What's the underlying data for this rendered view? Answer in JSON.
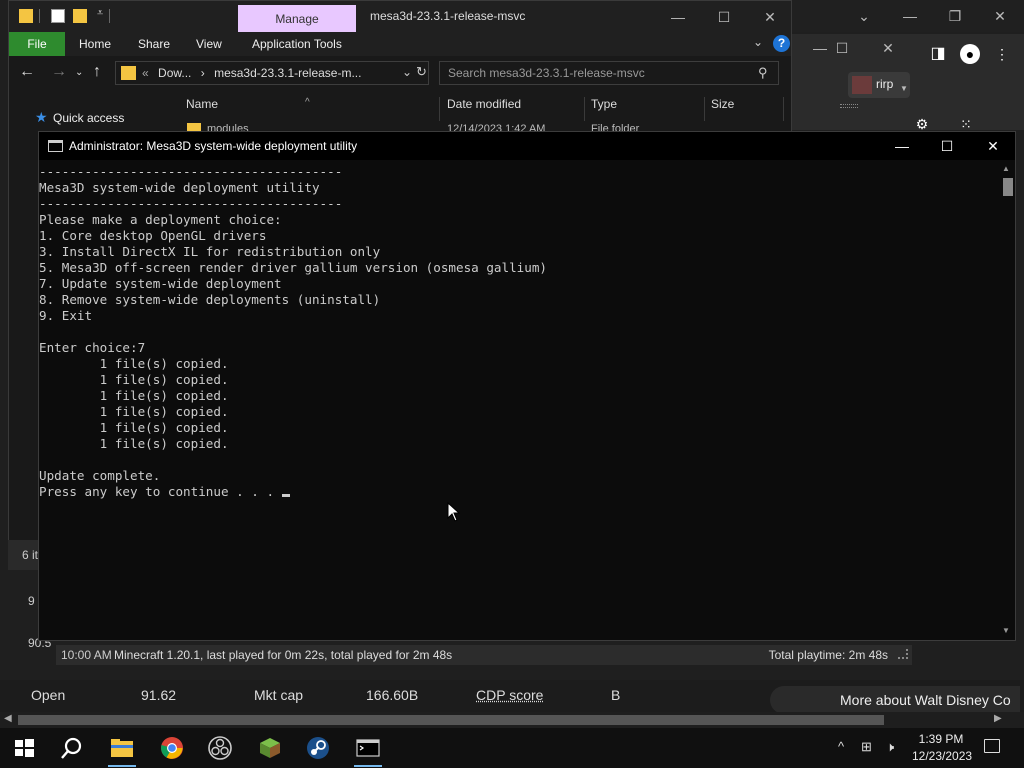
{
  "explorer": {
    "manage_tab": "Manage",
    "title": "mesa3d-23.3.1-release-msvc",
    "ribbon": {
      "file": "File",
      "tabs": [
        "Home",
        "Share",
        "View",
        "Application Tools"
      ]
    },
    "address_segments": [
      "«",
      "Dow...",
      "›",
      "mesa3d-23.3.1-release-m..."
    ],
    "search_placeholder": "Search mesa3d-23.3.1-release-msvc",
    "nav": {
      "quick_access": "Quick access"
    },
    "columns": [
      "Name",
      "Date modified",
      "Type",
      "Size"
    ],
    "first_row": {
      "name": "modules",
      "date": "12/14/2023 1:42 AM",
      "type": "File folder"
    },
    "status_items": "6 it"
  },
  "browser": {
    "profile_name": "rirp"
  },
  "console": {
    "title": "Administrator:  Mesa3D system-wide deployment utility",
    "lines": [
      "----------------------------------------",
      "Mesa3D system-wide deployment utility",
      "----------------------------------------",
      "Please make a deployment choice:",
      "1. Core desktop OpenGL drivers",
      "3. Install DirectX IL for redistribution only",
      "5. Mesa3D off-screen render driver gallium version (osmesa gallium)",
      "7. Update system-wide deployment",
      "8. Remove system-wide deployments (uninstall)",
      "9. Exit",
      "",
      "Enter choice:7",
      "        1 file(s) copied.",
      "        1 file(s) copied.",
      "        1 file(s) copied.",
      "        1 file(s) copied.",
      "        1 file(s) copied.",
      "        1 file(s) copied.",
      "",
      "Update complete.",
      "Press any key to continue . . . "
    ]
  },
  "minecraft_status": {
    "time": "10:00 AM",
    "text": "Minecraft 1.20.1, last played for 0m 22s, total played for 2m 48s",
    "total": "Total playtime: 2m 48s"
  },
  "stocks": {
    "open_label": "Open",
    "open_value": "91.62",
    "mktcap_label": "Mkt cap",
    "mktcap_value": "166.60B",
    "cdp_label": "CDP score",
    "cdp_value": "B",
    "more_about": "More about Walt Disney Co",
    "left_num1": "9",
    "left_num2": "90.5"
  },
  "taskbar": {
    "time": "1:39 PM",
    "date": "12/23/2023",
    "accent": "#76b9ed"
  },
  "colors": {
    "manage_tab": "#e8c8ff",
    "ribbon_file": "#2e8b2e",
    "folder": "#f4c542",
    "console_bg": "#0c0c0c"
  }
}
